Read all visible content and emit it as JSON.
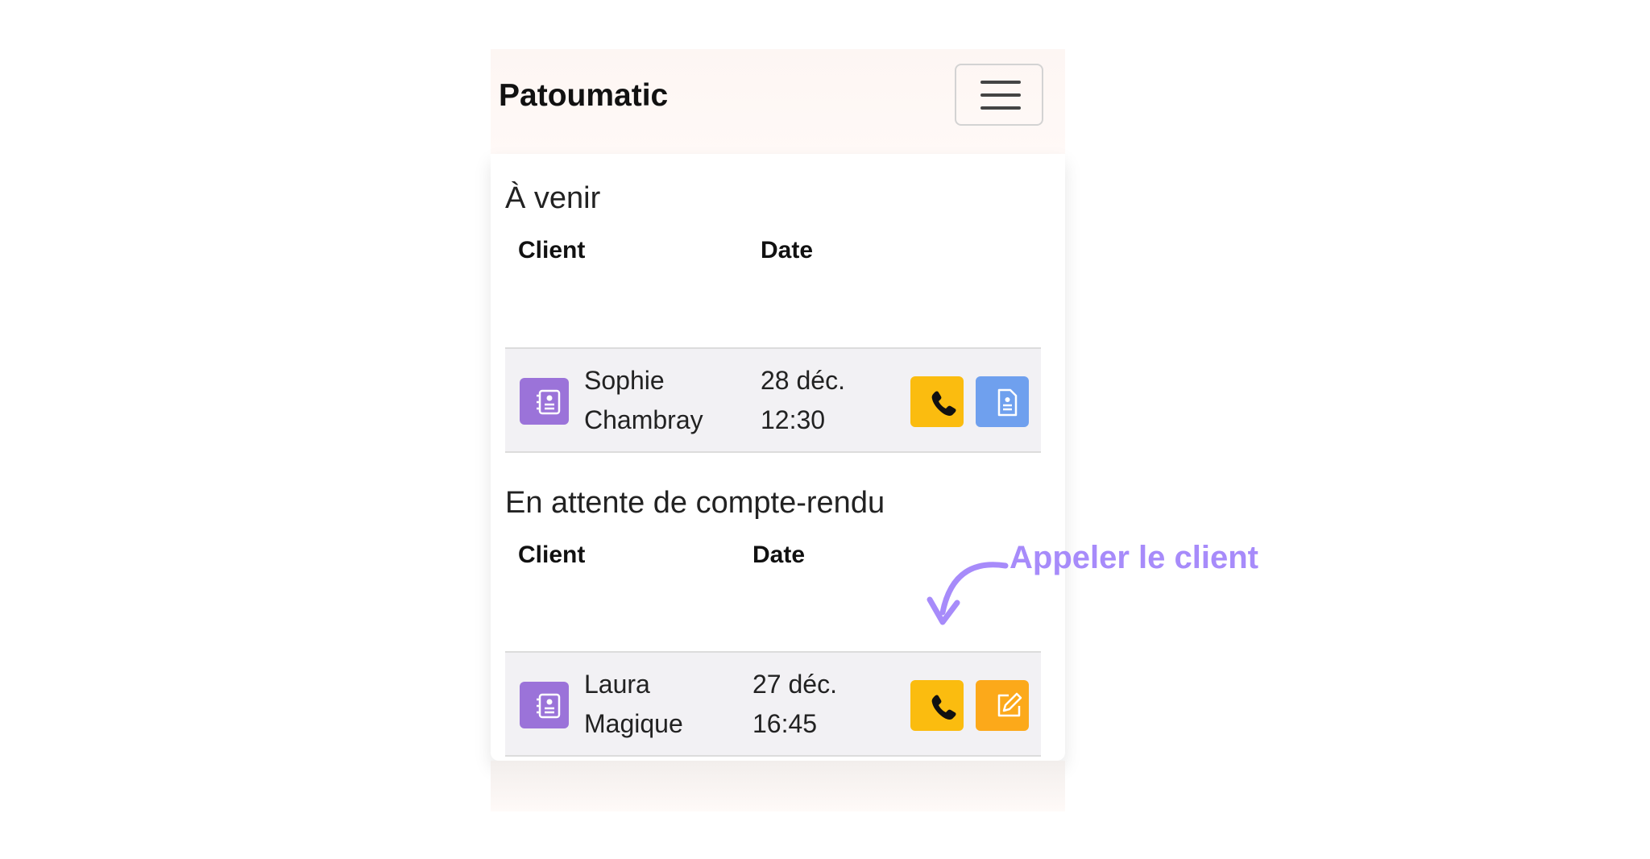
{
  "app": {
    "brand": "Patoumatic"
  },
  "sections": [
    {
      "title": "À venir",
      "columns": {
        "client": "Client",
        "date": "Date"
      },
      "rows": [
        {
          "client_first": "Sophie",
          "client_last": "Chambray",
          "date_day": "28 déc.",
          "date_time": "12:30",
          "actions": [
            "phone-icon",
            "document-icon"
          ]
        }
      ]
    },
    {
      "title": "En attente de compte-rendu",
      "columns": {
        "client": "Client",
        "date": "Date"
      },
      "rows": [
        {
          "client_first": "Laura",
          "client_last": "Magique",
          "date_day": "27 déc.",
          "date_time": "16:45",
          "actions": [
            "phone-icon",
            "edit-icon"
          ]
        }
      ]
    }
  ],
  "annotation": {
    "text": "Appeler le client"
  },
  "colors": {
    "contact_purple": "#9b73d9",
    "call_yellow": "#fbbc0f",
    "document_blue": "#6fa0ee",
    "edit_orange": "#fca91a",
    "annotation_purple": "#a78bfa"
  }
}
